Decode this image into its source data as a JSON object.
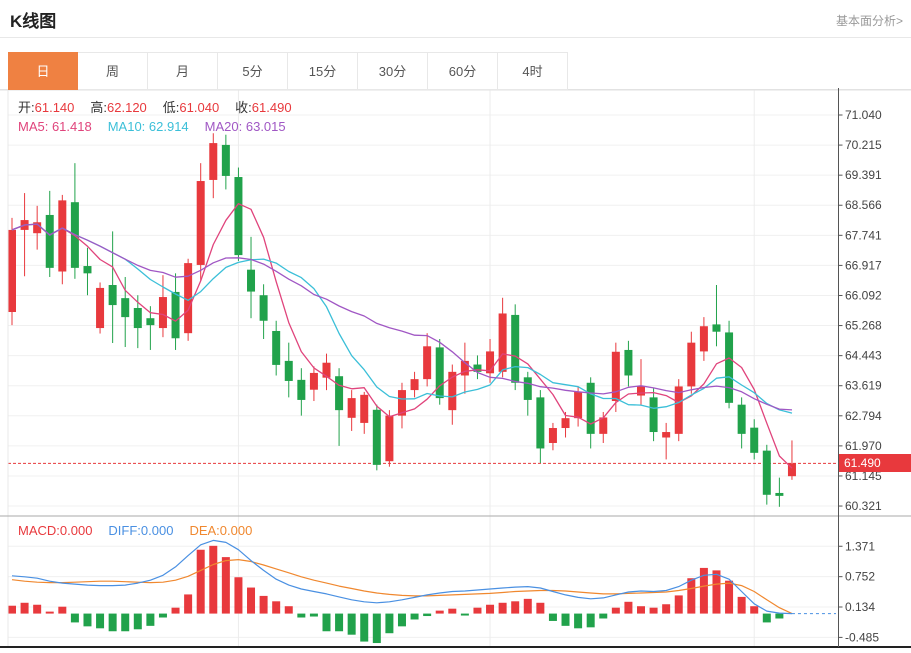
{
  "header": {
    "title": "K线图",
    "link": "基本面分析>"
  },
  "tabs": {
    "active_index": 0,
    "items": [
      {
        "label": "日"
      },
      {
        "label": "周"
      },
      {
        "label": "月"
      },
      {
        "label": "5分"
      },
      {
        "label": "15分"
      },
      {
        "label": "30分"
      },
      {
        "label": "60分"
      },
      {
        "label": "4时"
      }
    ]
  },
  "ohlc": {
    "pairs": [
      {
        "label": "开:",
        "value": "61.140"
      },
      {
        "label": "高:",
        "value": "62.120"
      },
      {
        "label": "低:",
        "value": "61.040"
      },
      {
        "label": "收:",
        "value": "61.490"
      }
    ]
  },
  "ma_legend": {
    "items": [
      {
        "text": "MA5: 61.418"
      },
      {
        "text": "MA10: 62.914"
      },
      {
        "text": "MA20: 63.015"
      }
    ]
  },
  "macd_legend": {
    "items": [
      {
        "text": "MACD:0.000"
      },
      {
        "text": "DIFF:0.000"
      },
      {
        "text": "DEA:0.000"
      }
    ]
  },
  "colors": {
    "up": "#e8393d",
    "down": "#21a24b",
    "tab_active": "#ef8142",
    "ma5": "#e0447c",
    "ma10": "#3bbfd8",
    "ma20": "#a057c4",
    "diff": "#4a90e2",
    "dea": "#f0882f",
    "badge_bg": "#e8393d",
    "grid": "#f0f0f0",
    "vgrid": "#ececec",
    "axis": "#555555"
  },
  "chart_data": {
    "type": "candlestick_with_macd",
    "title": "K线图 日K (daily candles with MA5/MA10/MA20 and MACD sub-panel)",
    "legend_position": "top-left",
    "grid": true,
    "main": {
      "y_ticks": [
        "71.040",
        "70.215",
        "69.391",
        "68.566",
        "67.741",
        "66.917",
        "66.092",
        "65.268",
        "64.443",
        "63.619",
        "62.794",
        "61.970",
        "61.145",
        "60.321"
      ],
      "ylim": [
        60.05,
        71.73
      ],
      "last_price": "61.490",
      "last_price_value": 61.49,
      "ma_periods": [
        5,
        10,
        20
      ],
      "ma_last_values": {
        "ma5": 61.418,
        "ma10": 62.914,
        "ma20": 63.015
      },
      "candles": [
        [
          65.64,
          68.22,
          65.28,
          67.89
        ],
        [
          67.89,
          68.9,
          66.62,
          68.16
        ],
        [
          67.8,
          68.55,
          67.35,
          68.1
        ],
        [
          68.3,
          68.96,
          66.6,
          66.85
        ],
        [
          66.75,
          68.85,
          66.4,
          68.7
        ],
        [
          68.65,
          69.72,
          66.55,
          66.85
        ],
        [
          66.9,
          67.4,
          66.1,
          66.7
        ],
        [
          65.2,
          66.45,
          65.05,
          66.3
        ],
        [
          66.38,
          67.85,
          64.79,
          65.83
        ],
        [
          66.02,
          66.6,
          64.68,
          65.5
        ],
        [
          65.75,
          66.1,
          64.65,
          65.2
        ],
        [
          65.47,
          65.8,
          64.6,
          65.28
        ],
        [
          65.2,
          66.65,
          64.95,
          66.05
        ],
        [
          66.19,
          66.7,
          64.6,
          64.92
        ],
        [
          65.06,
          67.1,
          64.85,
          66.98
        ],
        [
          66.93,
          69.72,
          66.5,
          69.23
        ],
        [
          69.26,
          70.54,
          68.76,
          70.27
        ],
        [
          70.22,
          70.5,
          69.0,
          69.37
        ],
        [
          69.34,
          69.6,
          67.04,
          67.2
        ],
        [
          66.8,
          67.7,
          65.47,
          66.2
        ],
        [
          66.1,
          66.4,
          64.9,
          65.4
        ],
        [
          65.12,
          65.4,
          63.9,
          64.19
        ],
        [
          64.3,
          64.8,
          63.3,
          63.75
        ],
        [
          63.78,
          64.1,
          62.8,
          63.23
        ],
        [
          63.51,
          64.15,
          63.2,
          63.97
        ],
        [
          63.84,
          64.5,
          63.5,
          64.25
        ],
        [
          63.88,
          64.1,
          61.97,
          62.95
        ],
        [
          62.74,
          63.5,
          62.38,
          63.28
        ],
        [
          62.6,
          63.45,
          62.3,
          63.37
        ],
        [
          62.96,
          63.1,
          61.3,
          61.45
        ],
        [
          61.55,
          62.95,
          61.4,
          62.8
        ],
        [
          62.8,
          63.7,
          62.45,
          63.5
        ],
        [
          63.5,
          64.0,
          63.3,
          63.8
        ],
        [
          63.8,
          65.06,
          63.6,
          64.7
        ],
        [
          64.67,
          64.9,
          63.1,
          63.28
        ],
        [
          62.95,
          64.2,
          62.55,
          64.0
        ],
        [
          63.9,
          64.8,
          63.4,
          64.3
        ],
        [
          64.2,
          64.45,
          63.8,
          64.0
        ],
        [
          63.96,
          64.9,
          63.7,
          64.56
        ],
        [
          64.0,
          66.03,
          63.85,
          65.6
        ],
        [
          65.56,
          65.85,
          63.5,
          63.7
        ],
        [
          63.85,
          64.0,
          62.8,
          63.23
        ],
        [
          63.3,
          63.5,
          61.5,
          61.9
        ],
        [
          62.05,
          62.6,
          61.85,
          62.46
        ],
        [
          62.46,
          62.9,
          62.2,
          62.73
        ],
        [
          62.73,
          63.6,
          62.5,
          63.46
        ],
        [
          63.7,
          63.85,
          61.9,
          62.3
        ],
        [
          62.3,
          62.9,
          62.05,
          62.75
        ],
        [
          63.2,
          64.8,
          62.9,
          64.55
        ],
        [
          64.6,
          64.85,
          63.6,
          63.9
        ],
        [
          63.35,
          64.35,
          63.1,
          63.6
        ],
        [
          63.3,
          63.55,
          62.1,
          62.35
        ],
        [
          62.2,
          62.6,
          61.6,
          62.35
        ],
        [
          62.3,
          63.8,
          62.1,
          63.6
        ],
        [
          63.6,
          65.1,
          63.4,
          64.8
        ],
        [
          64.56,
          65.5,
          64.3,
          65.25
        ],
        [
          65.3,
          66.38,
          64.7,
          65.1
        ],
        [
          65.08,
          65.4,
          63.0,
          63.15
        ],
        [
          63.1,
          63.3,
          61.9,
          62.3
        ],
        [
          62.47,
          62.7,
          61.6,
          61.78
        ],
        [
          61.84,
          62.0,
          60.36,
          60.63
        ],
        [
          60.68,
          61.1,
          60.3,
          60.6
        ],
        [
          61.14,
          62.12,
          61.04,
          61.49
        ]
      ]
    },
    "macd": {
      "y_ticks": [
        "1.371",
        "0.752",
        "0.134",
        "-0.485"
      ],
      "ylim": [
        -0.66,
        1.9
      ],
      "histogram": [
        0.16,
        0.22,
        0.18,
        0.04,
        0.14,
        -0.18,
        -0.26,
        -0.3,
        -0.36,
        -0.36,
        -0.32,
        -0.25,
        -0.08,
        0.12,
        0.39,
        1.3,
        1.38,
        1.15,
        0.74,
        0.53,
        0.36,
        0.25,
        0.15,
        -0.08,
        -0.06,
        -0.36,
        -0.36,
        -0.43,
        -0.57,
        -0.6,
        -0.4,
        -0.26,
        -0.12,
        -0.05,
        0.06,
        0.1,
        -0.04,
        0.12,
        0.18,
        0.22,
        0.25,
        0.3,
        0.22,
        -0.15,
        -0.25,
        -0.3,
        -0.28,
        -0.1,
        0.12,
        0.24,
        0.15,
        0.12,
        0.19,
        0.37,
        0.72,
        0.93,
        0.88,
        0.67,
        0.34,
        0.15,
        -0.18,
        -0.1,
        0.0
      ],
      "diff": [
        0.77,
        0.75,
        0.72,
        0.66,
        0.62,
        0.6,
        0.58,
        0.57,
        0.57,
        0.58,
        0.62,
        0.68,
        0.78,
        0.95,
        1.18,
        1.4,
        1.49,
        1.45,
        1.3,
        1.08,
        0.88,
        0.7,
        0.58,
        0.5,
        0.45,
        0.4,
        0.34,
        0.28,
        0.24,
        0.22,
        0.24,
        0.28,
        0.33,
        0.38,
        0.42,
        0.45,
        0.46,
        0.48,
        0.5,
        0.52,
        0.54,
        0.55,
        0.52,
        0.45,
        0.38,
        0.33,
        0.3,
        0.32,
        0.38,
        0.44,
        0.46,
        0.45,
        0.47,
        0.55,
        0.68,
        0.78,
        0.8,
        0.7,
        0.45,
        0.2,
        0.05,
        0.01,
        0.0
      ],
      "dea": [
        0.69,
        0.66,
        0.64,
        0.63,
        0.63,
        0.64,
        0.65,
        0.66,
        0.66,
        0.65,
        0.64,
        0.63,
        0.64,
        0.68,
        0.76,
        0.88,
        1.0,
        1.08,
        1.1,
        1.06,
        0.99,
        0.91,
        0.83,
        0.75,
        0.68,
        0.62,
        0.56,
        0.51,
        0.46,
        0.42,
        0.39,
        0.37,
        0.36,
        0.36,
        0.37,
        0.38,
        0.39,
        0.4,
        0.41,
        0.43,
        0.45,
        0.46,
        0.47,
        0.47,
        0.46,
        0.44,
        0.42,
        0.4,
        0.4,
        0.41,
        0.42,
        0.43,
        0.44,
        0.47,
        0.51,
        0.56,
        0.6,
        0.62,
        0.57,
        0.45,
        0.28,
        0.12,
        0.0
      ]
    },
    "x_gridline_indices": [
      18,
      38,
      59
    ]
  }
}
